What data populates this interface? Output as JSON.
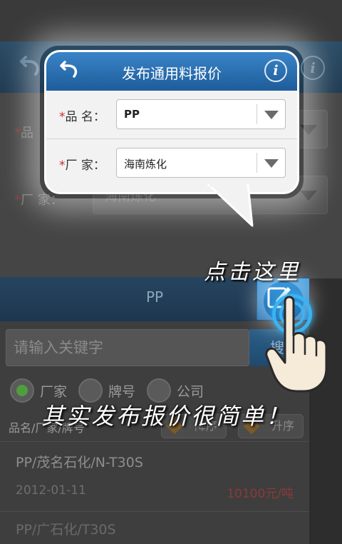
{
  "background_app": {
    "form": {
      "product_label": "品",
      "maker_label": "厂        家：",
      "maker_value": "海南炼化"
    },
    "panel": {
      "title": "PP",
      "search_placeholder": "请输入关键字",
      "search_button": "搜",
      "radios": [
        {
          "label": "厂家",
          "selected": true
        },
        {
          "label": "牌号",
          "selected": false
        },
        {
          "label": "公司",
          "selected": false
        }
      ],
      "column_header": "品名/厂家/牌号",
      "sort_desc_label": "降序",
      "sort_asc_label": "升序",
      "list": [
        {
          "name": "PP/茂名石化/N-T30S",
          "date": "2012-01-11",
          "price": "10100元/吨"
        },
        {
          "name": "PP/广石化/T30S",
          "date": "",
          "price": ""
        }
      ]
    }
  },
  "popup": {
    "title": "发布通用料报价",
    "info_icon": "i",
    "rows": [
      {
        "label": "品    名：",
        "value": "PP"
      },
      {
        "label": "厂    家：",
        "value": "海南炼化"
      }
    ],
    "required_mark": "*"
  },
  "overlay": {
    "hint_tap": "点击这里",
    "hint_easy": "其实发布报价很简单！"
  },
  "colors": {
    "title_bar_blue": "#1d5c9a",
    "accent_blue": "#3cb3f0",
    "required_red": "#d12a2a",
    "price_red": "#8b3a3a"
  }
}
